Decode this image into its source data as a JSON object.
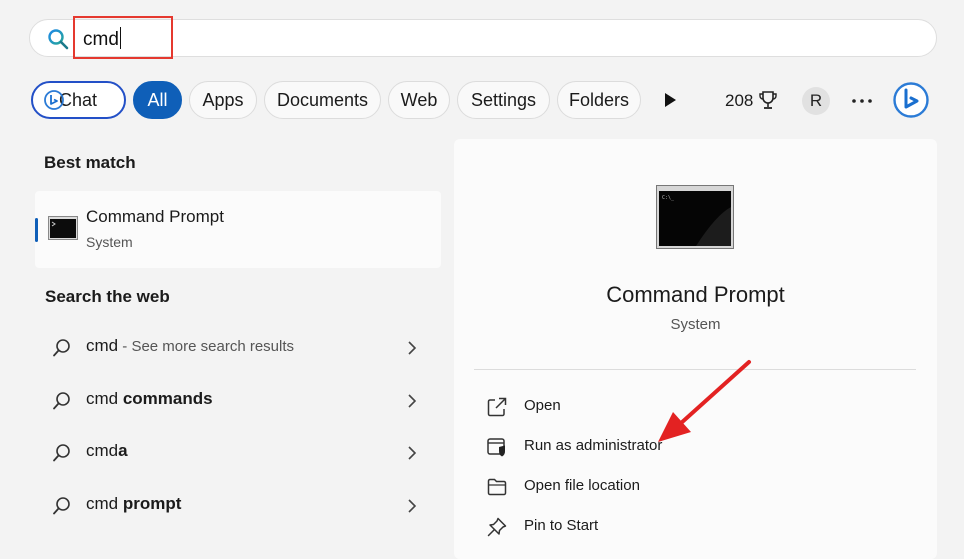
{
  "search": {
    "query": "cmd"
  },
  "filters": {
    "chat": "Chat",
    "all": "All",
    "apps": "Apps",
    "documents": "Documents",
    "web": "Web",
    "settings": "Settings",
    "folders": "Folders"
  },
  "header": {
    "points": "208",
    "avatar_initial": "R"
  },
  "best_match": {
    "heading": "Best match",
    "title": "Command Prompt",
    "subtitle": "System"
  },
  "web_search": {
    "heading": "Search the web",
    "rows": [
      {
        "plain": "cmd",
        "bold": "",
        "suffix": " - See more search results"
      },
      {
        "plain": "cmd ",
        "bold": "commands",
        "suffix": ""
      },
      {
        "plain": "cmd",
        "bold": "a",
        "suffix": ""
      },
      {
        "plain": "cmd ",
        "bold": "prompt",
        "suffix": ""
      }
    ]
  },
  "details": {
    "title": "Command Prompt",
    "subtitle": "System",
    "actions": [
      {
        "label": "Open",
        "icon": "open-external-icon"
      },
      {
        "label": "Run as administrator",
        "icon": "shield-admin-icon"
      },
      {
        "label": "Open file location",
        "icon": "folder-icon"
      },
      {
        "label": "Pin to Start",
        "icon": "pin-icon"
      }
    ]
  },
  "colors": {
    "accent": "#0f5fb8",
    "highlight": "#e5392f",
    "chat_border": "#2350c7"
  }
}
